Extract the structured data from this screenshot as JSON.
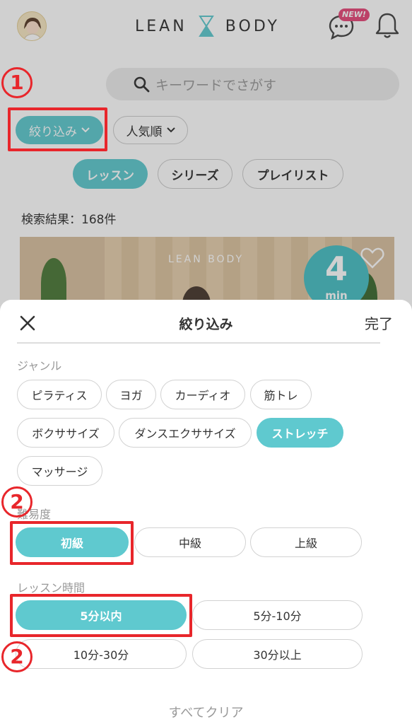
{
  "header": {
    "logo_left": "LEAN",
    "logo_right": "BODY",
    "new_badge": "NEW!"
  },
  "search": {
    "placeholder": "キーワードでさがす"
  },
  "filters": {
    "filter_label": "絞り込み",
    "sort_label": "人気順"
  },
  "content_tabs": [
    {
      "label": "レッスン",
      "selected": true
    },
    {
      "label": "シリーズ",
      "selected": false
    },
    {
      "label": "プレイリスト",
      "selected": false
    }
  ],
  "results": {
    "label": "検索結果：168件"
  },
  "thumbnail": {
    "logo_text": "LEAN BODY",
    "duration_number": "4",
    "duration_unit": "min"
  },
  "annotations": {
    "step1": "1",
    "step2": "2"
  },
  "sheet": {
    "title": "絞り込み",
    "done_label": "完了",
    "genre": {
      "label": "ジャンル",
      "options": [
        {
          "label": "ピラティス",
          "selected": false
        },
        {
          "label": "ヨガ",
          "selected": false
        },
        {
          "label": "カーディオ",
          "selected": false
        },
        {
          "label": "筋トレ",
          "selected": false
        },
        {
          "label": "ボクササイズ",
          "selected": false
        },
        {
          "label": "ダンスエクササイズ",
          "selected": false
        },
        {
          "label": "ストレッチ",
          "selected": true
        },
        {
          "label": "マッサージ",
          "selected": false
        }
      ]
    },
    "difficulty": {
      "label": "難易度",
      "options": [
        {
          "label": "初級",
          "selected": true
        },
        {
          "label": "中級",
          "selected": false
        },
        {
          "label": "上級",
          "selected": false
        }
      ]
    },
    "duration": {
      "label": "レッスン時間",
      "options": [
        {
          "label": "5分以内",
          "selected": true
        },
        {
          "label": "5分-10分",
          "selected": false
        },
        {
          "label": "10分-30分",
          "selected": false
        },
        {
          "label": "30分以上",
          "selected": false
        }
      ]
    },
    "clear_label": "すべてクリア"
  },
  "colors": {
    "accent": "#5fc9cf",
    "annotation_red": "#e8262b",
    "badge_pink": "#e64a7a"
  }
}
